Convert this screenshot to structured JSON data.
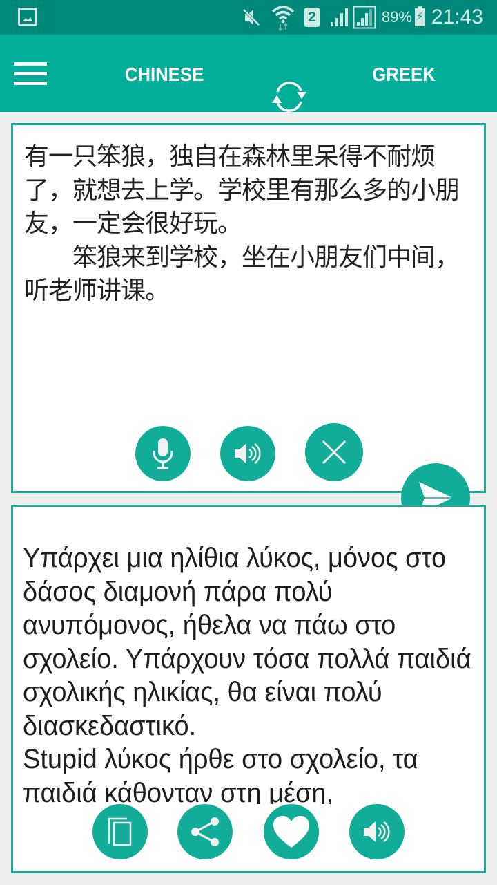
{
  "status_bar": {
    "left_icon": "gallery-icon",
    "icons": [
      "mute-icon",
      "wifi-data-icon",
      "sim-2-icon",
      "signal-icon",
      "signal-icon"
    ],
    "sim_label": "2",
    "battery_percent": "89%",
    "battery_state": "charging",
    "time": "21:43"
  },
  "app_bar": {
    "menu_icon": "hamburger-menu-icon",
    "source_language": "CHINESE",
    "swap_icon": "swap-languages-icon",
    "target_language": "GREEK"
  },
  "source_panel": {
    "text": "有一只笨狼，独自在森林里呆得不耐烦了，就想去上学。学校里有那么多的小朋友，一定会很好玩。\n　　笨狼来到学校，坐在小朋友们中间，听老师讲课。",
    "actions": [
      {
        "name": "microphone",
        "icon": "microphone-icon"
      },
      {
        "name": "speak",
        "icon": "speaker-icon"
      },
      {
        "name": "clear",
        "icon": "close-icon"
      }
    ]
  },
  "translate_button": {
    "icon": "send-icon"
  },
  "target_panel": {
    "text": "Υπάρχει μια ηλίθια λύκος, μόνος στο δάσος διαμονή πάρα πολύ ανυπόμονος, ήθελα να πάω στο σχολείο. Υπάρχουν τόσα πολλά παιδιά σχολικής ηλικίας, θα είναι πολύ διασκεδαστικό.\nStupid λύκος ήρθε στο σχολείο, τα παιδιά κάθονταν στη μέση,",
    "actions": [
      {
        "name": "copy",
        "icon": "copy-icon"
      },
      {
        "name": "share",
        "icon": "share-icon"
      },
      {
        "name": "favorite",
        "icon": "heart-icon"
      },
      {
        "name": "speak",
        "icon": "speaker-icon"
      }
    ]
  },
  "colors": {
    "status_bar": "#00897b",
    "app_bar": "#00ae99",
    "accent": "#11ad99",
    "panel_border": "#1ba99a",
    "background": "#eeeeee"
  }
}
